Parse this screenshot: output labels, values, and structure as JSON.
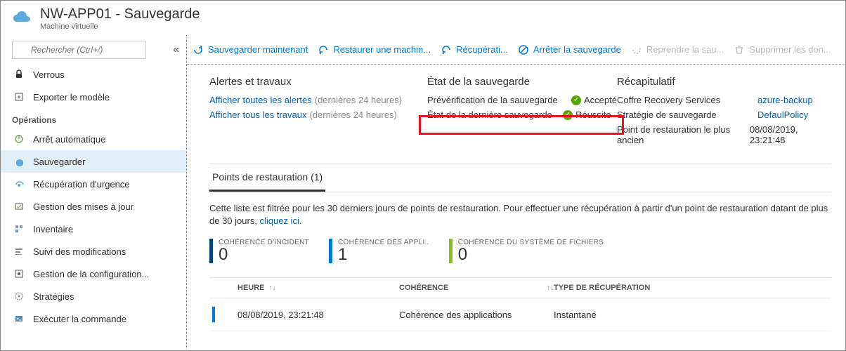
{
  "header": {
    "title": "NW-APP01 - Sauvegarde",
    "subtitle": "Machine virtuelle"
  },
  "search": {
    "placeholder": "Rechercher (Ctrl+/)"
  },
  "nav": {
    "top": [
      {
        "label": "Verrous",
        "icon": "lock"
      },
      {
        "label": "Exporter le modèle",
        "icon": "export"
      }
    ],
    "section": "Opérations",
    "ops": [
      {
        "label": "Arrêt automatique",
        "icon": "power"
      },
      {
        "label": "Sauvegarder",
        "icon": "backup",
        "active": true
      },
      {
        "label": "Récupération d'urgence",
        "icon": "recovery"
      },
      {
        "label": "Gestion des mises à jour",
        "icon": "updates"
      },
      {
        "label": "Inventaire",
        "icon": "inventory"
      },
      {
        "label": "Suivi des modifications",
        "icon": "tracking"
      },
      {
        "label": "Gestion de la configuration...",
        "icon": "config"
      },
      {
        "label": "Stratégies",
        "icon": "policy"
      },
      {
        "label": "Exécuter la commande",
        "icon": "run"
      }
    ]
  },
  "toolbar": [
    {
      "label": "Sauvegarder maintenant",
      "icon": "refresh"
    },
    {
      "label": "Restaurer une machin...",
      "icon": "undo"
    },
    {
      "label": "Récupérati...",
      "icon": "undo"
    },
    {
      "label": "Arrêter la sauvegarde",
      "icon": "stop"
    },
    {
      "label": "Reprendre la sau...",
      "icon": "resume",
      "disabled": true
    },
    {
      "label": "Supprimer les don...",
      "icon": "trash",
      "disabled": true
    }
  ],
  "alerts": {
    "heading": "Alertes et travaux",
    "rows": [
      {
        "link": "Afficher toutes les alertes",
        "suffix": "(dernières 24 heures)"
      },
      {
        "link": "Afficher tous les travaux",
        "suffix": "(dernières 24 heures)"
      }
    ]
  },
  "status": {
    "heading": "État de la sauvegarde",
    "rows": [
      {
        "label": "Prévérification de la sauvegarde",
        "value": "Accepté"
      },
      {
        "label": "État de la dernière sauvegarde",
        "value": "Réussite",
        "suffix": " -"
      }
    ]
  },
  "recap": {
    "heading": "Récapitulatif",
    "rows": [
      {
        "label": "Coffre Recovery Services",
        "value": "azure-backup",
        "link": true
      },
      {
        "label": "Stratégie de sauvegarde",
        "value": "DefaulPolicy",
        "link": true
      },
      {
        "label": "Point de restauration le plus ancien",
        "value": "08/08/2019, 23:21:48",
        "link": false
      }
    ]
  },
  "restore": {
    "tab": "Points de restauration (1)",
    "note_prefix": "Cette liste est filtrée pour les 30 derniers jours de points de restauration. Pour effectuer une récupération à partir d'un point de restauration datant de plus de 30 jours, ",
    "note_link": "cliquez ici",
    "note_suffix": ".",
    "metrics": [
      {
        "label": "COHÉRENCE D'INCIDENT",
        "value": "0",
        "color": "#004578"
      },
      {
        "label": "COHÉRENCE DES APPLI..",
        "value": "1",
        "color": "#0078d4"
      },
      {
        "label": "COHÉRENCE DU SYSTÈME DE FICHIERS",
        "value": "0",
        "color": "#8cbd18"
      }
    ],
    "columns": {
      "c1": "HEURE",
      "c2": "COHÉRENCE",
      "c3": "TYPE DE RÉCUPÉRATION"
    },
    "rows": [
      {
        "heure": "08/08/2019, 23:21:48",
        "coherence": "Cohérence des applications",
        "type": "Instantané"
      }
    ]
  }
}
